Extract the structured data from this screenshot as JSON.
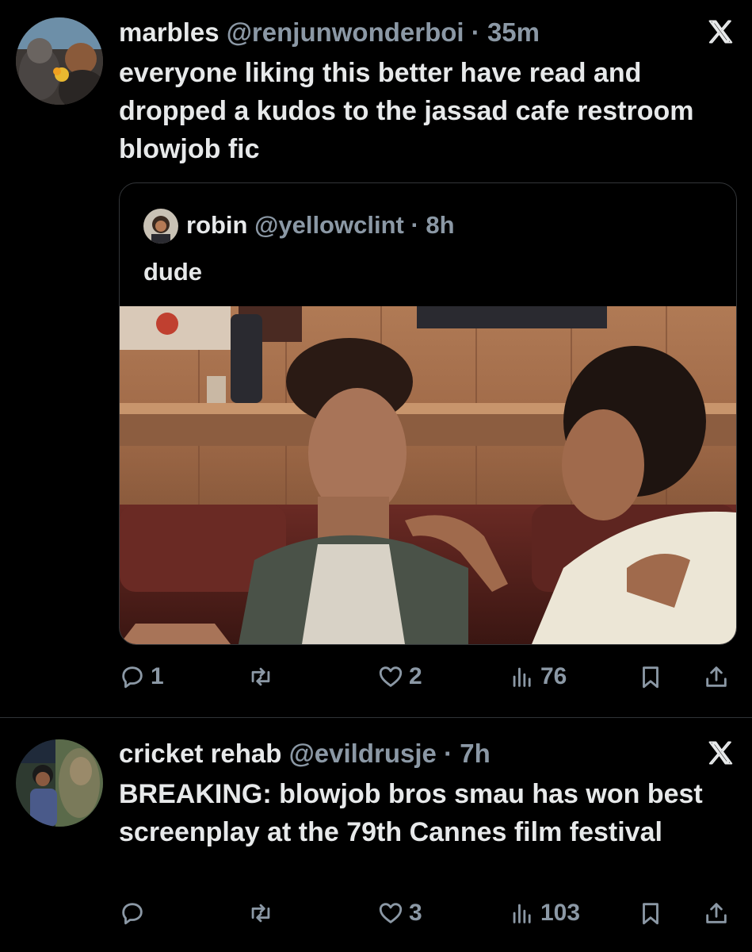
{
  "tweets": [
    {
      "name": "marbles",
      "handle": "@renjunwonderboi",
      "dot": "·",
      "time": "35m",
      "text": "everyone liking this better have read and dropped a kudos to the jassad cafe restroom blowjob fic",
      "quote": {
        "name": "robin",
        "handle": "@yellowclint",
        "dot": "·",
        "time": "8h",
        "text": "dude"
      },
      "actions": {
        "replies": "1",
        "reposts": "",
        "likes": "2",
        "views": "76"
      }
    },
    {
      "name": "cricket rehab",
      "handle": "@evildrusje",
      "dot": "·",
      "time": "7h",
      "text": "BREAKING: blowjob bros smau has won best screenplay at the 79th Cannes film festival",
      "actions": {
        "replies": "",
        "reposts": "",
        "likes": "3",
        "views": "103"
      }
    }
  ],
  "icons": {
    "reply": "reply-icon",
    "repost": "repost-icon",
    "like": "heart-icon",
    "views": "views-icon",
    "bookmark": "bookmark-icon",
    "share": "share-icon",
    "brand": "x-logo-icon"
  },
  "colors": {
    "background": "#000000",
    "text": "#e7e9ea",
    "muted": "#8b98a5",
    "border": "#333639"
  }
}
